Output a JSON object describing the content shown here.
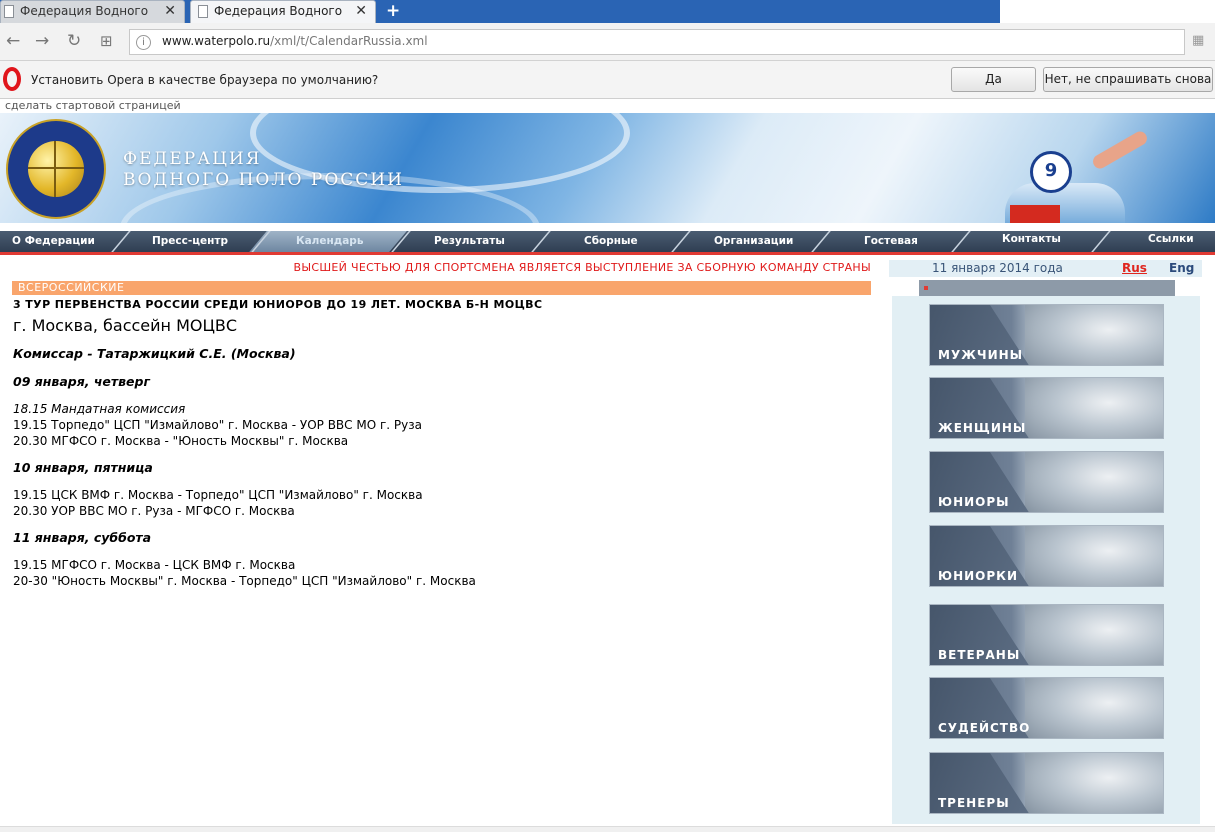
{
  "browser": {
    "tabs": [
      {
        "title": "Федерация Водного По",
        "active": false
      },
      {
        "title": "Федерация Водного По",
        "active": true
      }
    ],
    "new_tab_label": "+",
    "address": {
      "host": "www.waterpolo.ru",
      "path": "/xml/t/CalendarRussia.xml"
    },
    "infobar": {
      "message": "Установить Opera в качестве браузера по умолчанию?",
      "yes_label": "Да",
      "no_label": "Нет, не спрашивать снова"
    },
    "icons": [
      "back-icon",
      "forward-icon",
      "reload-icon",
      "speed-dial-icon",
      "site-info-icon",
      "opera-logo-icon"
    ]
  },
  "page": {
    "start_page_link": "сделать стартовой страницей",
    "header": {
      "line1": "ФЕДЕРАЦИЯ",
      "line2": "ВОДНОГО ПОЛО РОССИИ",
      "cap_number": "9"
    },
    "nav": [
      {
        "label": "О Федерации"
      },
      {
        "label": "Пресс-центр"
      },
      {
        "label": "Календарь",
        "active": true
      },
      {
        "label": "Результаты"
      },
      {
        "label": "Сборные"
      },
      {
        "label": "Организации"
      },
      {
        "label": "Гостевая"
      },
      {
        "label": "Контакты"
      },
      {
        "label": "Ссылки"
      }
    ],
    "ticker": "ВЫСШЕЙ ЧЕСТЬЮ ДЛЯ СПОРТСМЕНА ЯВЛЯЕТСЯ ВЫСТУПЛЕНИЕ ЗА СБОРНУЮ КОМАНДУ СТРАНЫ",
    "category": "ВСЕРОССИЙСКИЕ",
    "event": {
      "title": "3 ТУР ПЕРВЕНСТВА РОССИИ СРЕДИ ЮНИОРОВ ДО 19 ЛЕТ. МОСКВА Б-Н МОЦВС",
      "place": "г. Москва, бассейн МОЦВС",
      "commissioner": "Комиссар - Татаржицкий С.Е. (Москва)",
      "days": [
        {
          "date": "09 января, четверг",
          "lines": [
            "18.15 Мандатная комиссия",
            "19.15 Торпедо\" ЦСП \"Измайлово\" г. Москва - УОР ВВС МО г. Руза",
            "20.30 МГФСО г. Москва - \"Юность Москвы\" г. Москва"
          ]
        },
        {
          "date": "10 января, пятница",
          "lines": [
            "19.15 ЦСК ВМФ г. Москва - Торпедо\" ЦСП \"Измайлово\" г. Москва",
            "20.30 УОР ВВС МО г. Руза - МГФСО г. Москва"
          ]
        },
        {
          "date": "11 января, суббота",
          "lines": [
            "19.15 МГФСО г. Москва - ЦСК ВМФ г. Москва",
            "20-30 \"Юность Москвы\" г. Москва - Торпедо\" ЦСП \"Измайлово\" г. Москва"
          ]
        }
      ]
    },
    "sidebar": {
      "date": "11 января 2014 года",
      "lang_rus": "Rus",
      "lang_eng": "Eng",
      "sections": [
        {
          "label": "МУЖЧИНЫ"
        },
        {
          "label": "ЖЕНЩИНЫ"
        },
        {
          "label": "ЮНИОРЫ"
        },
        {
          "label": "ЮНИОРКИ"
        },
        {
          "label": "ВЕТЕРАНЫ"
        },
        {
          "label": "СУДЕЙСТВО"
        },
        {
          "label": "ТРЕНЕРЫ"
        }
      ]
    }
  },
  "colors": {
    "tabbar": "#2a64b4",
    "nav_dark": "#2f3e52",
    "nav_red_line": "#e03a33",
    "ticker_text": "#e01a1a",
    "category_bar": "#f9a56c",
    "sidebar_bg": "#e2eff4"
  }
}
